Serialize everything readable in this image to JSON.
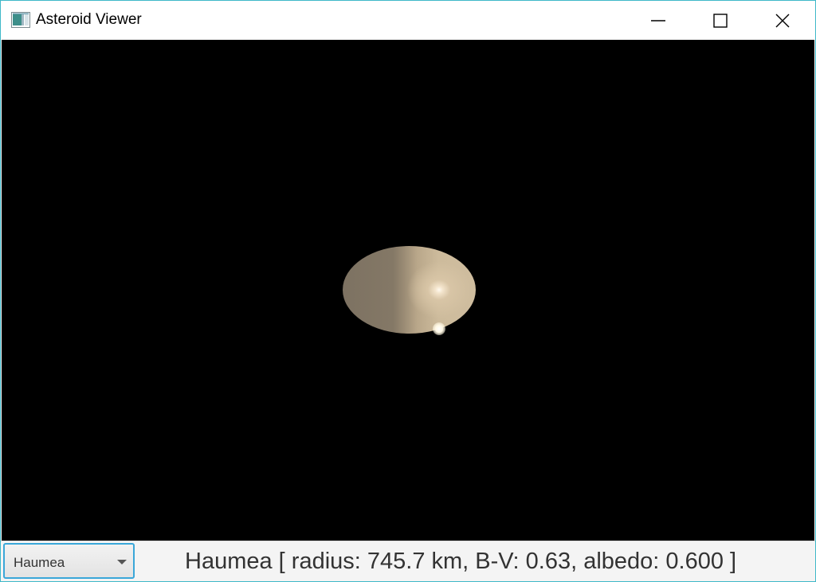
{
  "window": {
    "title": "Asteroid Viewer",
    "icon": "app-window-icon",
    "border_color": "#3fb8c9"
  },
  "viewport": {
    "background_color": "#000000",
    "object": "Haumea",
    "object_colors": {
      "shadow": "#7d7262",
      "lit": "#cfbd9f",
      "highlight": "#fffaf0"
    }
  },
  "controls": {
    "asteroid_select": {
      "value": "Haumea",
      "icon": "chevron-down-icon",
      "focus_color": "#3aa7d9"
    },
    "info_text": "Haumea [ radius: 745.7 km, B-V: 0.63, albedo: 0.600 ]"
  }
}
